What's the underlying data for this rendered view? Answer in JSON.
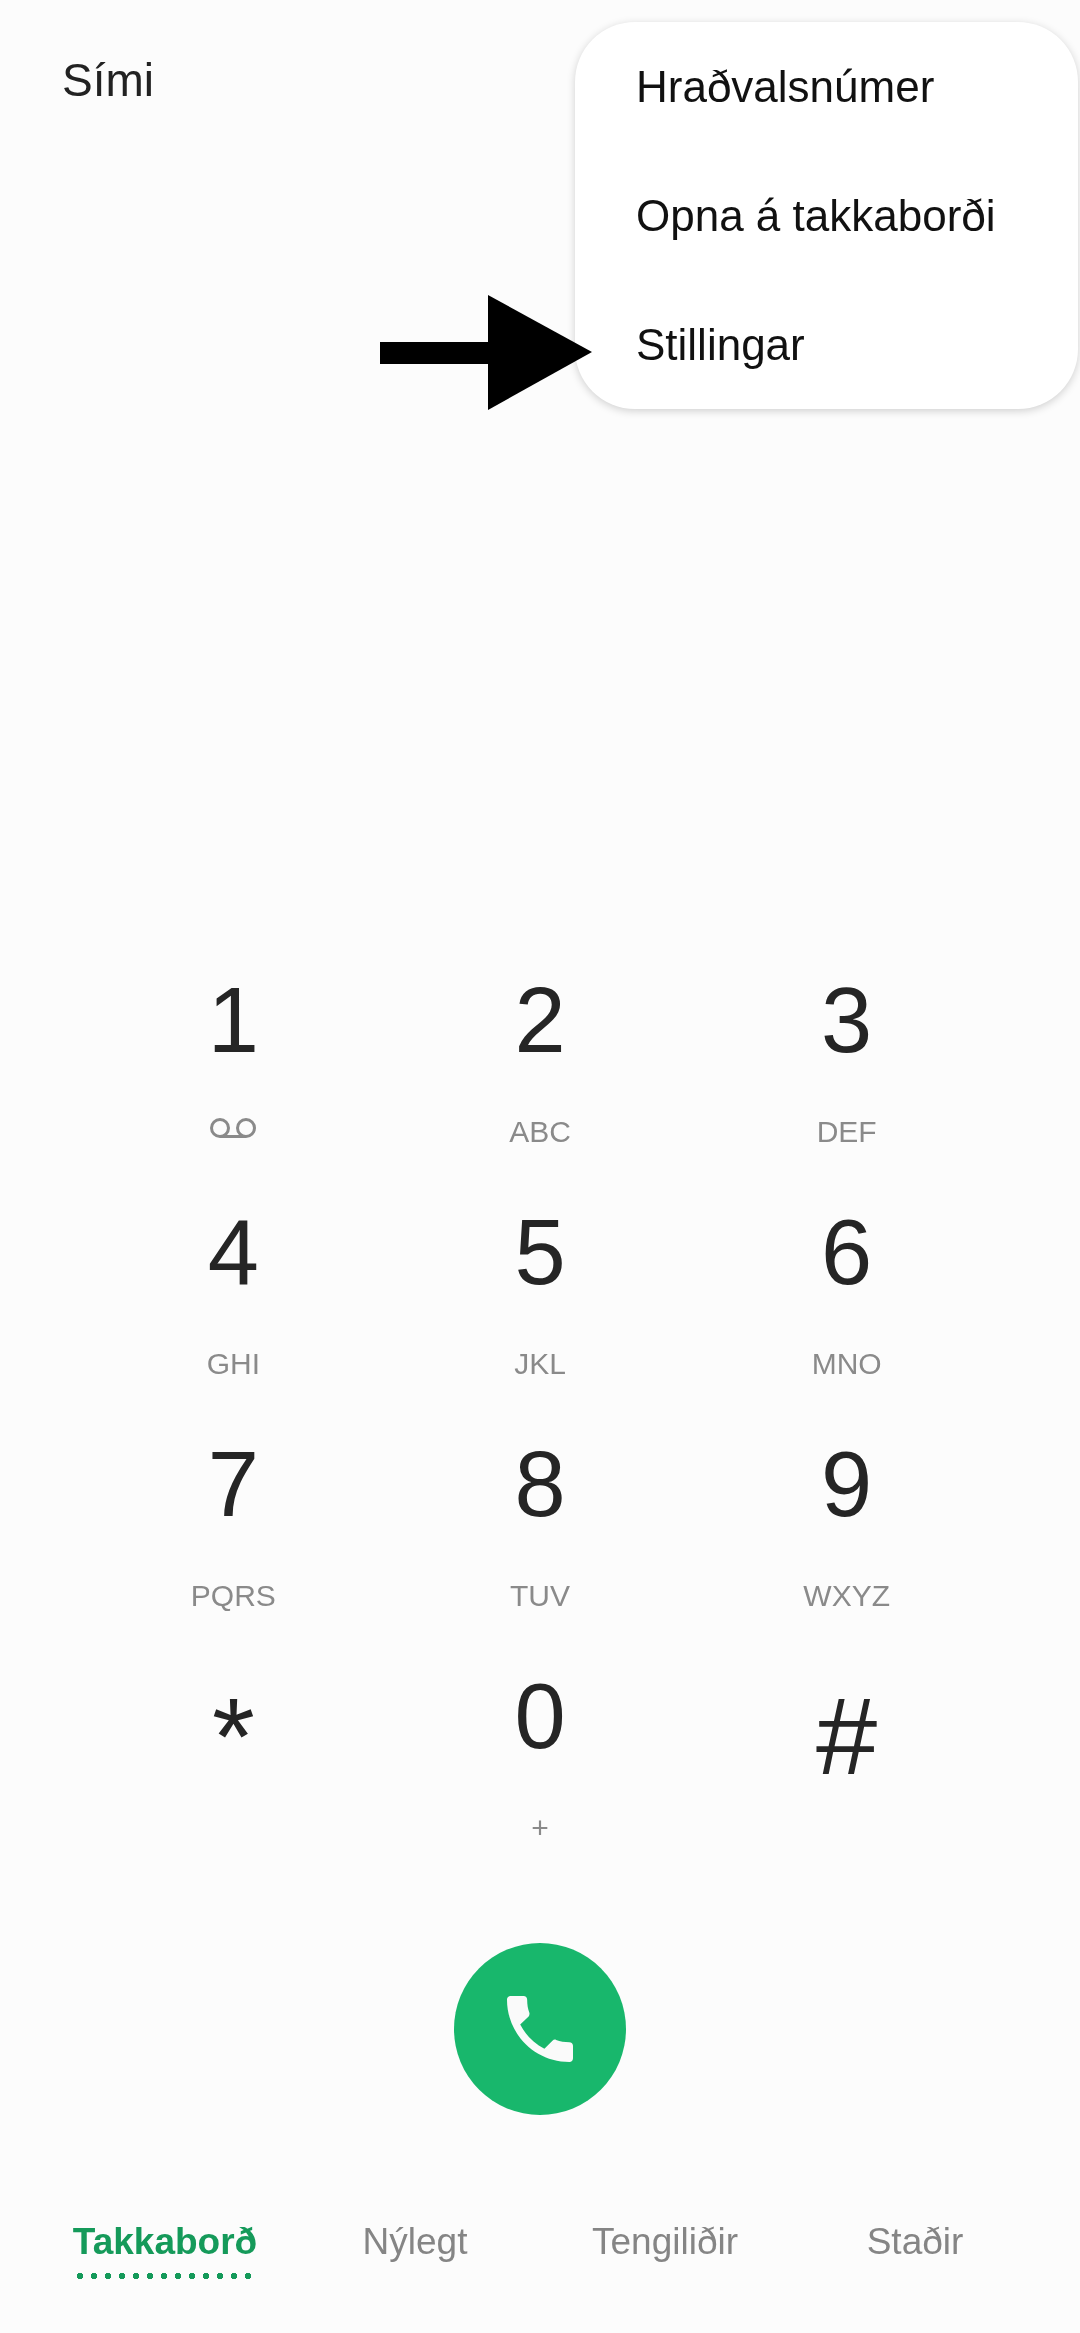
{
  "app_title": "Sími",
  "menu": [
    {
      "label": "Hraðvalsnúmer"
    },
    {
      "label": "Opna á takkaborði"
    },
    {
      "label": "Stillingar"
    }
  ],
  "annotation": {
    "kind": "arrow"
  },
  "keys": [
    {
      "digit": "1",
      "kind": "voicemail"
    },
    {
      "digit": "2",
      "kind": "letters",
      "sub": "ABC"
    },
    {
      "digit": "3",
      "kind": "letters",
      "sub": "DEF"
    },
    {
      "digit": "4",
      "kind": "letters",
      "sub": "GHI"
    },
    {
      "digit": "5",
      "kind": "letters",
      "sub": "JKL"
    },
    {
      "digit": "6",
      "kind": "letters",
      "sub": "MNO"
    },
    {
      "digit": "7",
      "kind": "letters",
      "sub": "PQRS"
    },
    {
      "digit": "8",
      "kind": "letters",
      "sub": "TUV"
    },
    {
      "digit": "9",
      "kind": "letters",
      "sub": "WXYZ"
    },
    {
      "digit": "*",
      "kind": "none"
    },
    {
      "digit": "0",
      "kind": "letters",
      "sub": "+"
    },
    {
      "digit": "#",
      "kind": "none"
    }
  ],
  "tabs": [
    {
      "label": "Takkaborð",
      "selected": true
    },
    {
      "label": "Nýlegt",
      "selected": false
    },
    {
      "label": "Tengiliðir",
      "selected": false
    },
    {
      "label": "Staðir",
      "selected": false
    }
  ]
}
